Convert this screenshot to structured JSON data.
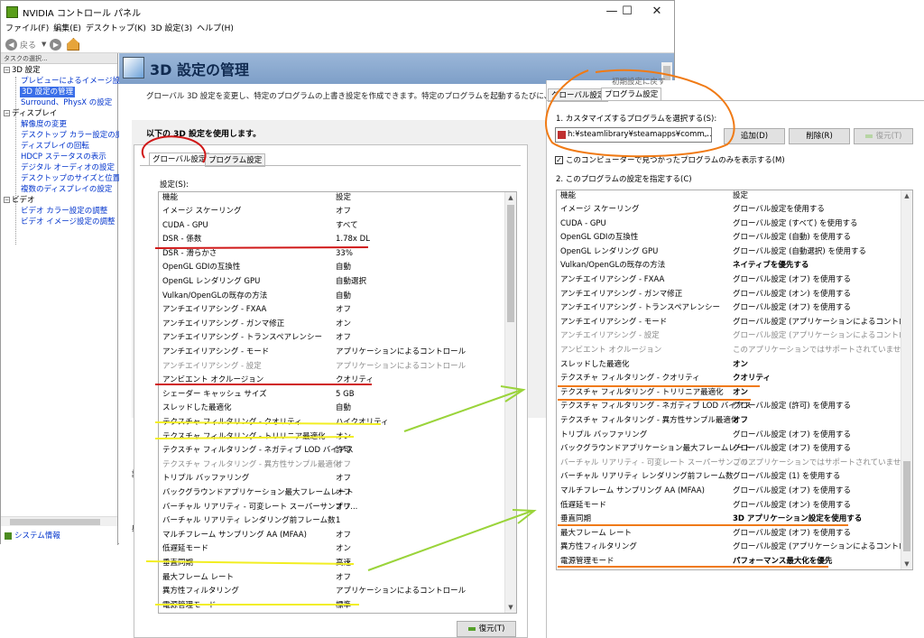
{
  "window": {
    "title": "NVIDIA コントロール パネル",
    "controls": {
      "minimize": "—",
      "maximize": "☐",
      "close": "✕"
    }
  },
  "menubar": [
    "ファイル(F)",
    "編集(E)",
    "デスクトップ(K)",
    "3D 設定(3)",
    "ヘルプ(H)"
  ],
  "toolbar": {
    "back_label": "戻る"
  },
  "tree": {
    "header": "タスクの選択...",
    "items": [
      {
        "label": "3D 設定",
        "kind": "cat"
      },
      {
        "label": "プレビューによるイメージ設定の",
        "kind": "link"
      },
      {
        "label": "3D 設定の管理",
        "kind": "sel"
      },
      {
        "label": "Surround、PhysX の設定",
        "kind": "link"
      },
      {
        "label": "ディスプレイ",
        "kind": "cat"
      },
      {
        "label": "解像度の変更",
        "kind": "link"
      },
      {
        "label": "デスクトップ カラー設定の調整",
        "kind": "link"
      },
      {
        "label": "ディスプレイの回転",
        "kind": "link"
      },
      {
        "label": "HDCP ステータスの表示",
        "kind": "link"
      },
      {
        "label": "デジタル オーディオの設定",
        "kind": "link"
      },
      {
        "label": "デスクトップのサイズと位置の調",
        "kind": "link"
      },
      {
        "label": "複数のディスプレイの設定",
        "kind": "link"
      },
      {
        "label": "ビデオ",
        "kind": "cat"
      },
      {
        "label": "ビデオ カラー設定の調整",
        "kind": "link"
      },
      {
        "label": "ビデオ イメージ設定の調整",
        "kind": "link"
      }
    ],
    "system_info": "システム情報"
  },
  "main": {
    "title": "3D 設定の管理",
    "description": "グローバル 3D 設定を変更し、特定のプログラムの上書き設定を作成できます。特定のプログラムを起動するたびに、上書き設定",
    "use_text": "以下の 3D 設定を使用します。",
    "explain_label": "説明",
    "explain_label2": "典型"
  },
  "left_panel": {
    "tabs": [
      "グローバル設定",
      "プログラム設定"
    ],
    "settings_label": "設定(S):",
    "col_feature": "機能",
    "col_setting": "設定",
    "restore_label": "復元(T)",
    "rows": [
      {
        "f": "イメージ スケーリング",
        "v": "オフ"
      },
      {
        "f": "CUDA - GPU",
        "v": "すべて"
      },
      {
        "f": "DSR - 係数",
        "v": "1.78x DL"
      },
      {
        "f": "DSR - 滑らかさ",
        "v": "33%"
      },
      {
        "f": "OpenGL GDIの互換性",
        "v": "自動"
      },
      {
        "f": "OpenGL レンダリング GPU",
        "v": "自動選択"
      },
      {
        "f": "Vulkan/OpenGLの既存の方法",
        "v": "自動"
      },
      {
        "f": "アンチエイリアシング - FXAA",
        "v": "オフ"
      },
      {
        "f": "アンチエイリアシング - ガンマ修正",
        "v": "オン"
      },
      {
        "f": "アンチエイリアシング - トランスペアレンシー",
        "v": "オフ"
      },
      {
        "f": "アンチエイリアシング - モード",
        "v": "アプリケーションによるコントロール"
      },
      {
        "f": "アンチエイリアシング - 設定",
        "v": "アプリケーションによるコントロール",
        "gray": true
      },
      {
        "f": "アンビエント オクルージョン",
        "v": "クオリティ"
      },
      {
        "f": "シェーダー キャッシュ サイズ",
        "v": "5 GB"
      },
      {
        "f": "スレッドした最適化",
        "v": "自動"
      },
      {
        "f": "テクスチャ フィルタリング - クオリティ",
        "v": "ハイクオリティ"
      },
      {
        "f": "テクスチャ フィルタリング - トリリニア最適化",
        "v": "オン"
      },
      {
        "f": "テクスチャ フィルタリング - ネガティブ LOD バイアス",
        "v": "許可"
      },
      {
        "f": "テクスチャ フィルタリング - 異方性サンプル最適化",
        "v": "オフ",
        "gray": true
      },
      {
        "f": "トリプル バッファリング",
        "v": "オフ"
      },
      {
        "f": "バックグラウンドアプリケーション最大フレームレート",
        "v": "オフ"
      },
      {
        "f": "バーチャル リアリティ - 可変レート スーパーサンプリ...",
        "v": "オフ"
      },
      {
        "f": "バーチャル リアリティ レンダリング前フレーム数",
        "v": "1"
      },
      {
        "f": "マルチフレーム サンプリング AA (MFAA)",
        "v": "オフ"
      },
      {
        "f": "低遅延モード",
        "v": "オン"
      },
      {
        "f": "垂直同期",
        "v": "高速"
      },
      {
        "f": "最大フレーム レート",
        "v": "オフ"
      },
      {
        "f": "異方性フィルタリング",
        "v": "アプリケーションによるコントロール"
      },
      {
        "f": "電源管理モード",
        "v": "標準"
      }
    ]
  },
  "right_panel": {
    "initial_defaults": "初期設定に戻す",
    "tabs": [
      "グローバル設定",
      "プログラム設定"
    ],
    "step1": "1. カスタマイズするプログラムを選択する(S):",
    "program_value": "h:¥steamlibrary¥steamapps¥comm...",
    "add_label": "追加(D)",
    "remove_label": "削除(R)",
    "restore_label": "復元(T)",
    "only_found_label": "このコンピューターで見つかったプログラムのみを表示する(M)",
    "step2": "2. このプログラムの設定を指定する(C)",
    "col_feature": "機能",
    "col_setting": "設定",
    "rows": [
      {
        "f": "イメージ スケーリング",
        "v": "グローバル設定を使用する"
      },
      {
        "f": "CUDA - GPU",
        "v": "グローバル設定 (すべて) を使用する"
      },
      {
        "f": "OpenGL GDIの互換性",
        "v": "グローバル設定 (自動) を使用する"
      },
      {
        "f": "OpenGL レンダリング GPU",
        "v": "グローバル設定 (自動選択) を使用する"
      },
      {
        "f": "Vulkan/OpenGLの既存の方法",
        "v": "ネイティブを優先する",
        "bold": true
      },
      {
        "f": "アンチエイリアシング - FXAA",
        "v": "グローバル設定 (オフ) を使用する"
      },
      {
        "f": "アンチエイリアシング - ガンマ修正",
        "v": "グローバル設定 (オン) を使用する"
      },
      {
        "f": "アンチエイリアシング - トランスペアレンシー",
        "v": "グローバル設定 (オフ) を使用する"
      },
      {
        "f": "アンチエイリアシング - モード",
        "v": "グローバル設定 (アプリケーションによるコントロール) ..."
      },
      {
        "f": "アンチエイリアシング - 設定",
        "v": "グローバル設定 (アプリケーションによるコントロール) ...",
        "gray": true
      },
      {
        "f": "アンビエント オクルージョン",
        "v": "このアプリケーションではサポートされていません",
        "gray": true
      },
      {
        "f": "スレッドした最適化",
        "v": "オン",
        "bold": true
      },
      {
        "f": "テクスチャ フィルタリング - クオリティ",
        "v": "クオリティ",
        "bold": true
      },
      {
        "f": "テクスチャ フィルタリング - トリリニア最適化",
        "v": "オン",
        "bold": true
      },
      {
        "f": "テクスチャ フィルタリング - ネガティブ LOD バイアス",
        "v": "グローバル設定 (許可) を使用する"
      },
      {
        "f": "テクスチャ フィルタリング - 異方性サンプル最適化",
        "v": "オフ",
        "bold": true
      },
      {
        "f": "トリプル バッファリング",
        "v": "グローバル設定 (オフ) を使用する"
      },
      {
        "f": "バックグラウンドアプリケーション最大フレームレート",
        "v": "グローバル設定 (オフ) を使用する"
      },
      {
        "f": "バーチャル リアリティ - 可変レート スーパーサンプリ...",
        "v": "このアプリケーションではサポートされていません",
        "gray": true
      },
      {
        "f": "バーチャル リアリティ レンダリング前フレーム数",
        "v": "グローバル設定 (1) を使用する"
      },
      {
        "f": "マルチフレーム サンプリング AA (MFAA)",
        "v": "グローバル設定 (オフ) を使用する"
      },
      {
        "f": "低遅延モード",
        "v": "グローバル設定 (オン) を使用する"
      },
      {
        "f": "垂直同期",
        "v": "3D アプリケーション設定を使用する",
        "bold": true
      },
      {
        "f": "最大フレーム レート",
        "v": "グローバル設定 (オフ) を使用する"
      },
      {
        "f": "異方性フィルタリング",
        "v": "グローバル設定 (アプリケーションによるコントロール) ..."
      },
      {
        "f": "電源管理モード",
        "v": "パフォーマンス最大化を優先",
        "bold": true
      }
    ]
  },
  "annotation_colors": {
    "red": "#d01818",
    "yellow": "#f2ee22",
    "orange": "#f07a14",
    "green": "#9ad43a"
  }
}
